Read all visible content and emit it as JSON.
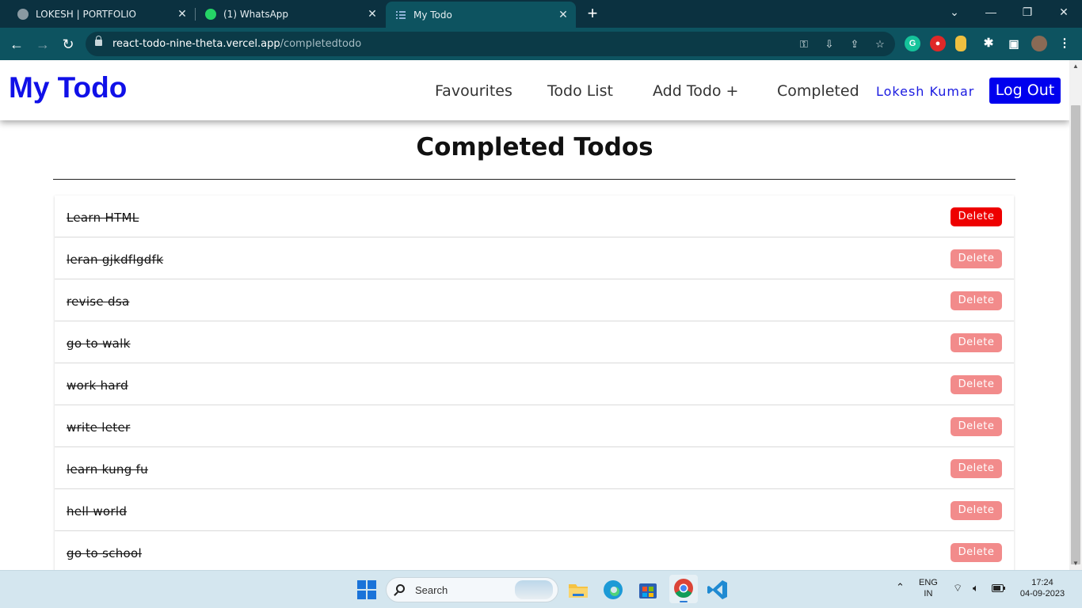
{
  "browser": {
    "tabs": [
      {
        "title": "LOKESH | PORTFOLIO"
      },
      {
        "title": "(1) WhatsApp"
      },
      {
        "title": "My Todo"
      }
    ],
    "url_host": "react-todo-nine-theta.vercel.app",
    "url_path": "/completedtodo"
  },
  "navbar": {
    "brand": "My Todo",
    "links": {
      "favourites": "Favourites",
      "todo_list": "Todo List",
      "add_todo": "Add Todo +",
      "completed": "Completed"
    },
    "user": "Lokesh Kumar",
    "logout": "Log Out"
  },
  "main": {
    "heading": "Completed Todos",
    "delete_label": "Delete",
    "todos": [
      "Learn HTML",
      "leran gjkdflgdfk",
      "revise dsa",
      "go to walk",
      "work hard",
      "write leter",
      "learn kung fu",
      "hell world",
      "go to school"
    ]
  },
  "taskbar": {
    "search_placeholder": "Search",
    "lang_top": "ENG",
    "lang_bottom": "IN",
    "time": "17:24",
    "date": "04-09-2023"
  },
  "colors": {
    "brand": "#1010e8",
    "logout_bg": "#0000ee",
    "delete_active": "#ee0000",
    "delete": "#f28b8b",
    "chrome_frame": "#0b3140",
    "chrome_toolbar": "#0d5360"
  }
}
